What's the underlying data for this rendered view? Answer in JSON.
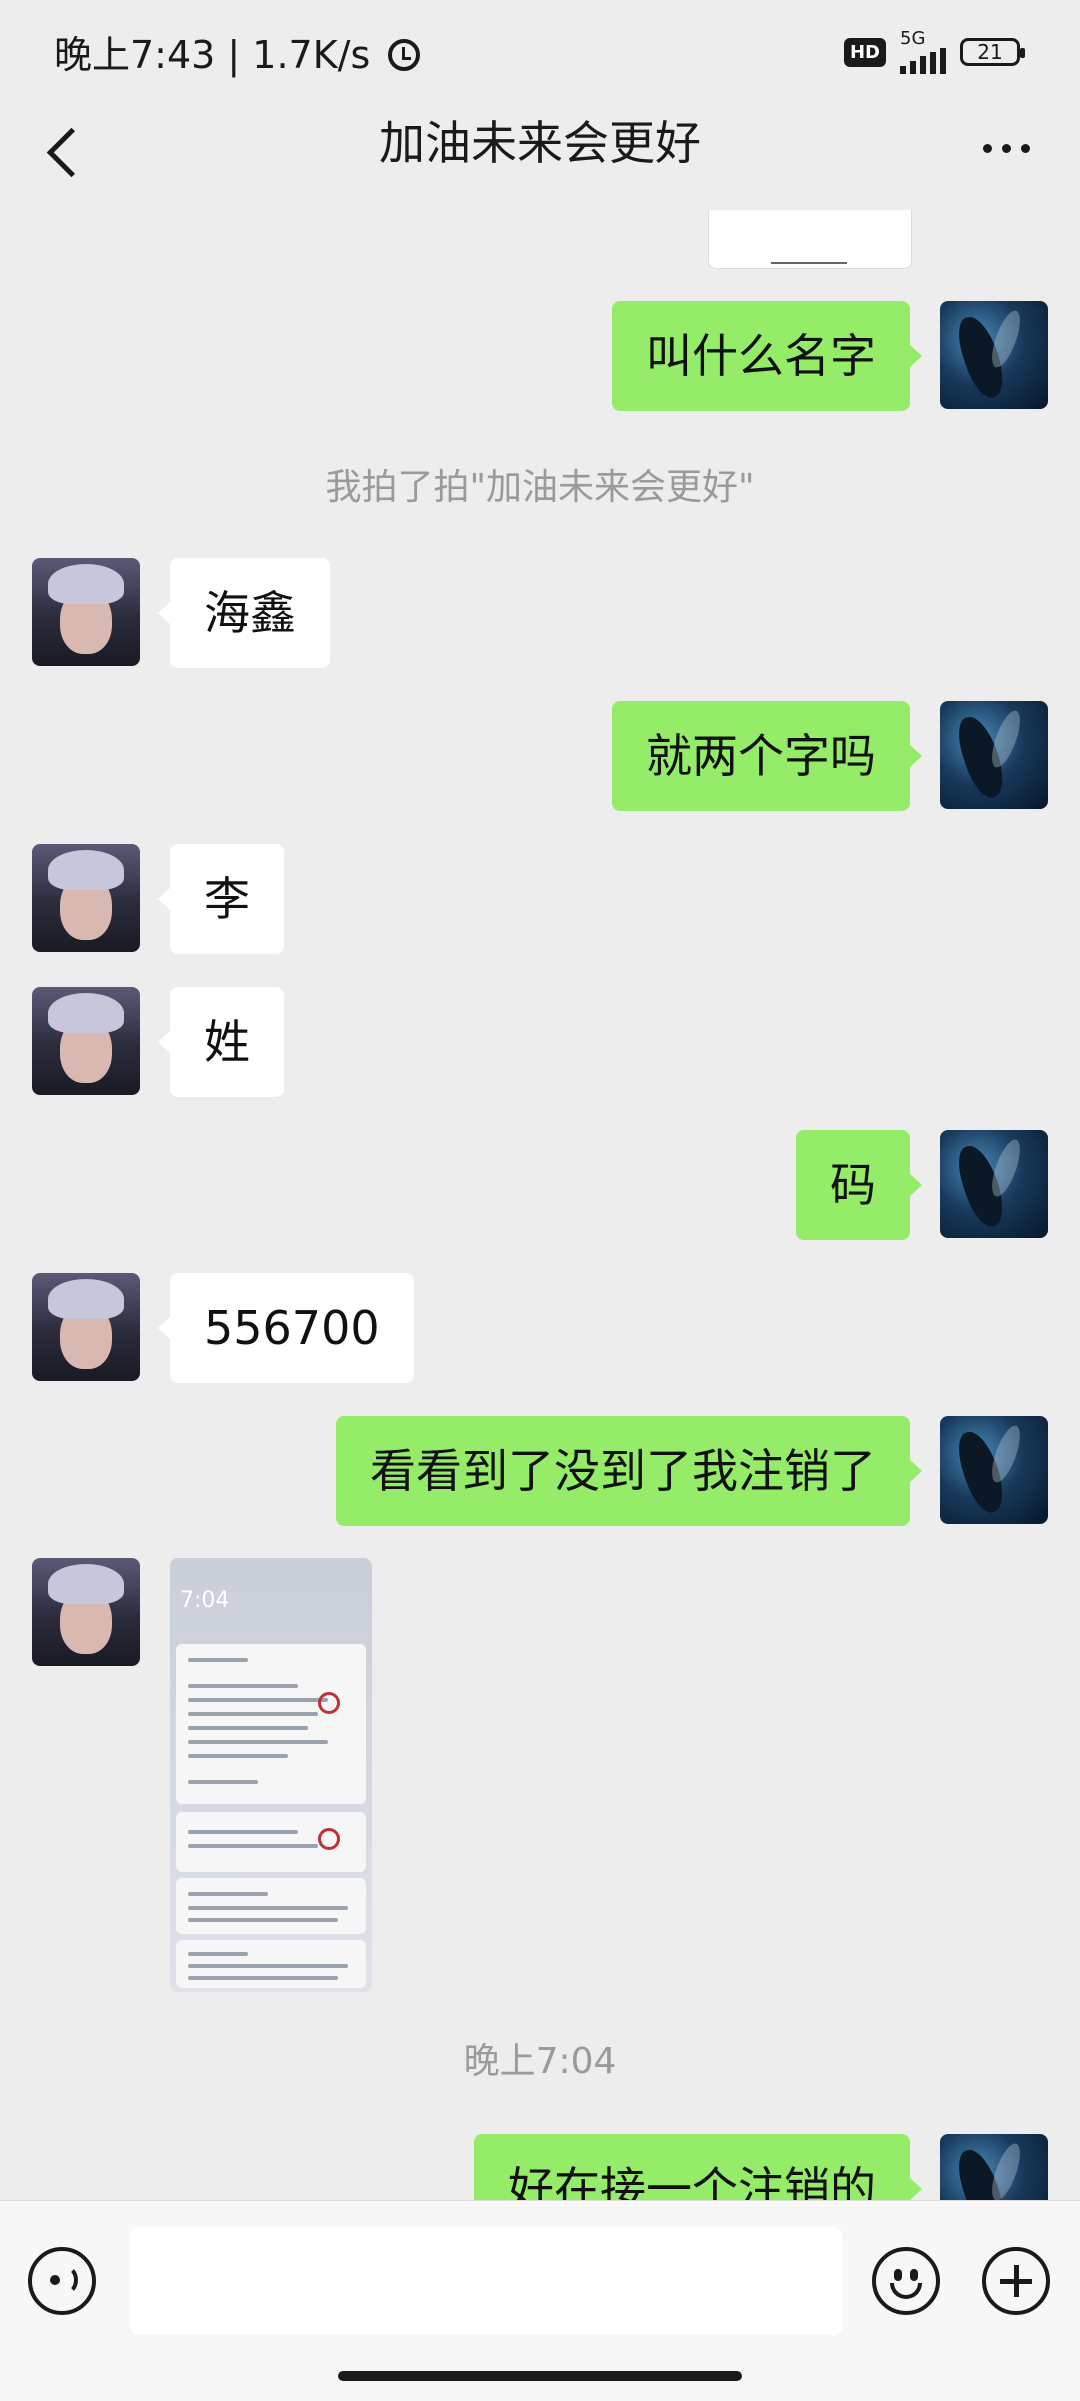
{
  "status_bar": {
    "time_speed": "晚上7:43 | 1.7K/s",
    "hd_badge": "HD",
    "network": "5G",
    "battery": "21"
  },
  "header": {
    "title": "加油未来会更好"
  },
  "messages": [
    {
      "side": "me",
      "text": "叫什么名字"
    },
    {
      "type": "system",
      "text": "我拍了拍\"加油未来会更好\""
    },
    {
      "side": "other",
      "text": "海鑫"
    },
    {
      "side": "me",
      "text": "就两个字吗"
    },
    {
      "side": "other",
      "text": "李"
    },
    {
      "side": "other",
      "text": "姓"
    },
    {
      "side": "me",
      "text": "码"
    },
    {
      "side": "other",
      "text": "556700"
    },
    {
      "side": "me",
      "text": "看看到了没到了我注销了"
    },
    {
      "side": "other",
      "type": "image",
      "image_caption": "7:04"
    },
    {
      "type": "timestamp",
      "text": "晚上7:04"
    },
    {
      "side": "me",
      "text": "好在接一个注销的"
    }
  ],
  "bottom_bar": {
    "input_value": ""
  }
}
